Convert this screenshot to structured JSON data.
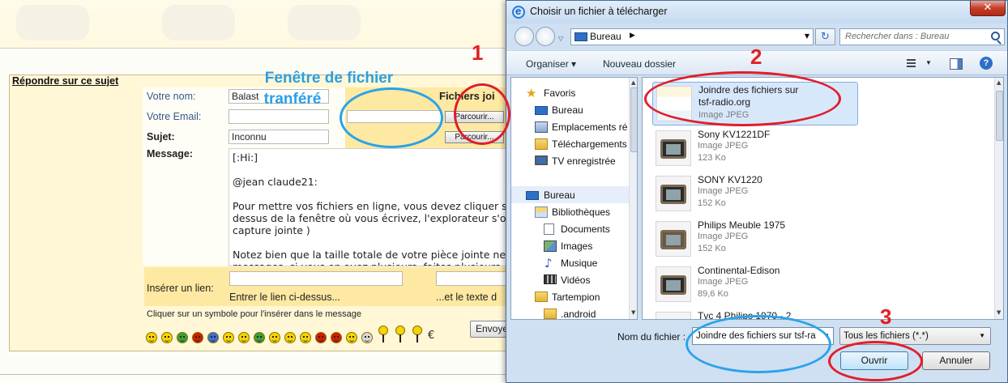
{
  "forum": {
    "reply_title": "Répondre sur ce sujet",
    "name_label": "Votre nom:",
    "name_value": "Balast",
    "email_label": "Votre Email:",
    "subject_label": "Sujet:",
    "subject_value": "Inconnu",
    "message_label": "Message:",
    "files_title": "Fichiers joi",
    "browse_label": "Parcourir...",
    "message_paragraphs": [
      "[:Hi:]",
      "@jean claude21:",
      "Pour mettre vos fichiers en ligne, vous devez cliquer s\ndessus de la fenêtre où vous écrivez, l'explorateur s'o\ncapture jointe )",
      "Notez bien que la taille totale de votre pièce jointe ne\nmessages, si vous en avez plusieurs, faites plusieurs"
    ],
    "link_label": "Insérer un lien:",
    "link_hint": "Entrer le lien ci-dessus...",
    "link_text_hint": "...et le texte d",
    "smiley_hint": "Cliquer sur un symbole pour l'insérer dans le message",
    "euro_symbol": "€",
    "send_label": "Envoyer"
  },
  "annotations": {
    "file_window_line1": "Fenêtre de fichier",
    "file_window_line2": "tranféré",
    "step1": "1",
    "step2": "2",
    "step3": "3",
    "circle_blue": "#2aa2ea",
    "circle_red": "#e01e2a"
  },
  "dialog": {
    "title": "Choisir un fichier à télécharger",
    "close_label": "✕",
    "address": "Bureau",
    "search_placeholder": "Rechercher dans : Bureau",
    "toolbar": {
      "organize": "Organiser ▾",
      "new_folder": "Nouveau dossier"
    },
    "nav": {
      "favorites": "Favoris",
      "desktop": "Bureau",
      "places": "Emplacements ré",
      "downloads": "Téléchargements",
      "tv": "TV enregistrée",
      "desktop_root": "Bureau",
      "libraries": "Bibliothèques",
      "documents": "Documents",
      "images": "Images",
      "music": "Musique",
      "videos": "Vidéos",
      "user": "Tartempion",
      "android": ".android"
    },
    "files": [
      {
        "name_line1": "Joindre des fichiers sur",
        "name_line2": "tsf-radio.org",
        "type": "Image JPEG",
        "size": ""
      },
      {
        "name_line1": "Sony KV1221DF",
        "name_line2": "",
        "type": "Image JPEG",
        "size": "123 Ko"
      },
      {
        "name_line1": "SONY KV1220",
        "name_line2": "",
        "type": "Image JPEG",
        "size": "152 Ko"
      },
      {
        "name_line1": "Philips Meuble 1975",
        "name_line2": "",
        "type": "Image JPEG",
        "size": "152 Ko"
      },
      {
        "name_line1": "Continental-Edison",
        "name_line2": "",
        "type": "Image JPEG",
        "size": "89,6 Ko"
      },
      {
        "name_line1": "Tvc 4 Philips 1970 - 2",
        "name_line2": "",
        "type": "",
        "size": ""
      }
    ],
    "filename_label": "Nom du fichier :",
    "filename_value": "Joindre des fichiers sur tsf-ra",
    "filter_value": "Tous les fichiers (*.*)",
    "open_label": "Ouvrir",
    "cancel_label": "Annuler"
  }
}
